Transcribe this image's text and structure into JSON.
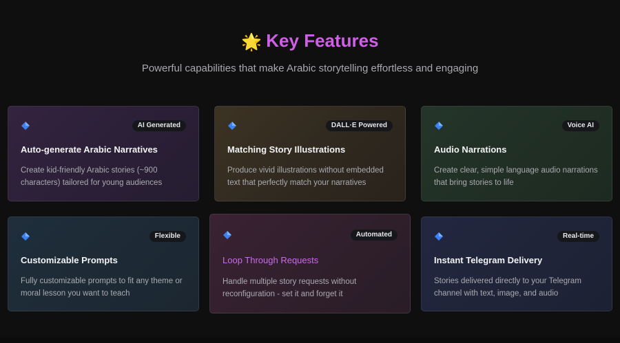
{
  "header": {
    "icon": "glowing-star-icon",
    "star_glyph": "🌟",
    "title": "Key Features",
    "subtitle": "Powerful capabilities that make Arabic storytelling effortless and engaging"
  },
  "colors": {
    "title_accent": "#cf5fe6",
    "diamond_icon": "#3b82f6"
  },
  "cards": [
    {
      "badge": "AI Generated",
      "title": "Auto-generate Arabic Narratives",
      "description": "Create kid-friendly Arabic stories (~900 characters) tailored for young audiences"
    },
    {
      "badge": "DALL·E Powered",
      "title": "Matching Story Illustrations",
      "description": "Produce vivid illustrations without embedded text that perfectly match your narratives"
    },
    {
      "badge": "Voice AI",
      "title": "Audio Narrations",
      "description": "Create clear, simple language audio narrations that bring stories to life"
    },
    {
      "badge": "Flexible",
      "title": "Customizable Prompts",
      "description": "Fully customizable prompts to fit any theme or moral lesson you want to teach"
    },
    {
      "badge": "Automated",
      "title": "Loop Through Requests",
      "description": "Handle multiple story requests without reconfiguration - set it and forget it"
    },
    {
      "badge": "Real-time",
      "title": "Instant Telegram Delivery",
      "description": "Stories delivered directly to your Telegram channel with text, image, and audio"
    }
  ]
}
